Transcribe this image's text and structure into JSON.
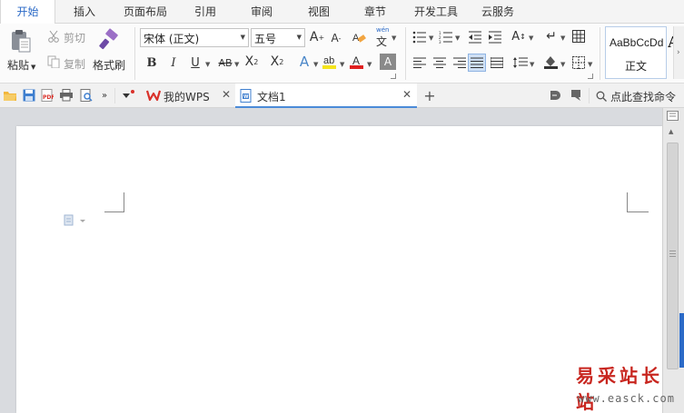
{
  "menu": {
    "tabs": [
      "开始",
      "插入",
      "页面布局",
      "引用",
      "审阅",
      "视图",
      "章节",
      "开发工具",
      "云服务"
    ],
    "active_index": 0
  },
  "clipboard": {
    "paste": "粘贴",
    "cut": "剪切",
    "copy": "复制",
    "format_painter": "格式刷"
  },
  "font": {
    "name": "宋体 (正文)",
    "size": "五号",
    "wen_label": "wén",
    "wen_char": "文"
  },
  "styles": {
    "sample": "AaBbCcDd",
    "name": "正文"
  },
  "quickbar": {
    "wps_tab": "我的WPS",
    "doc_tab": "文档1",
    "search": "点此查找命令"
  },
  "watermark": {
    "cn": "易采站长站",
    "en": "www.easck.com"
  },
  "colors": {
    "accent": "#2b6ac7",
    "wps_red": "#d9312a",
    "font_color_red": "#e02020",
    "highlight_yellow": "#f5e51c"
  }
}
